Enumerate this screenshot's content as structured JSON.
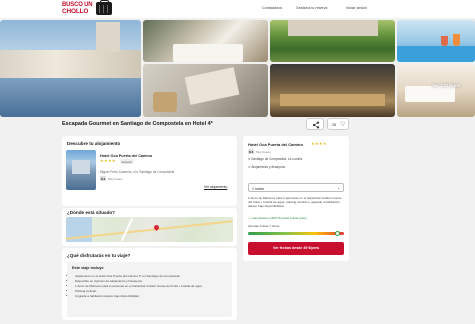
{
  "header": {
    "logo_line1": "BUSCO UN",
    "logo_line2": "CHOLLO",
    "nav": [
      "Contáctanos",
      "Gestiona tu reserva",
      "Iniciar sesión"
    ]
  },
  "gallery": {
    "photo_count_label": "Ver 110 fotos"
  },
  "title": "Escapada Gourmet en Santiago de Compostela en Hotel 4*",
  "actions": {
    "likes": "26"
  },
  "accommodation": {
    "heading": "Descubre tu alojamiento",
    "hotel_name": "Hotel Oca Puerta del Camino",
    "stars": "★★★★",
    "tag": "Superior",
    "address": "Miguel Ferro Caaveiro, s/n, Santiago de Compostela",
    "rating": "8.4",
    "rating_label": "Muy bueno",
    "link": "Ver alojamiento"
  },
  "location": {
    "heading": "¿Dónde está situado?"
  },
  "enjoy": {
    "heading": "¿Qué disfrutarás en tu viaje?",
    "included_heading": "Este viaje incluye",
    "items": [
      "Alojamiento en el Hotel Oca Puerta del Camino 4* en Santiago de Compostela.",
      "Disponible en régimen de Alojamiento y Desayuno.",
      "1 Arroz de Mariscos para 2 personas en el Gastrobar Golden Goose del hotel + botella de agua.",
      "Parking incluido.",
      "Upgrade a habitación deluxe bajo disponibilidad."
    ]
  },
  "booking": {
    "hotel_name": "Hotel Oca Puerta del Camino",
    "stars": "★★★★",
    "rating": "8.4",
    "rating_label": "Muy bueno",
    "location": "Santiago de Compostela, La coruña",
    "board": "Alojamiento y desayuno",
    "select_value": "1 noche",
    "description": "1 Arroz de Mariscos para 2 personas en el Gastrobar Golden Goose del hotel + botella de agua, parking incluido y upgrade a habitación deluxe bajo disponibilidad.",
    "cancel_text": "Cancelación GRATIS hasta 3 días antes",
    "remaining": "Quedan 9 días 7 horas",
    "progress": 0.93,
    "cta": "Ver fechas desde 49 €/pers"
  }
}
